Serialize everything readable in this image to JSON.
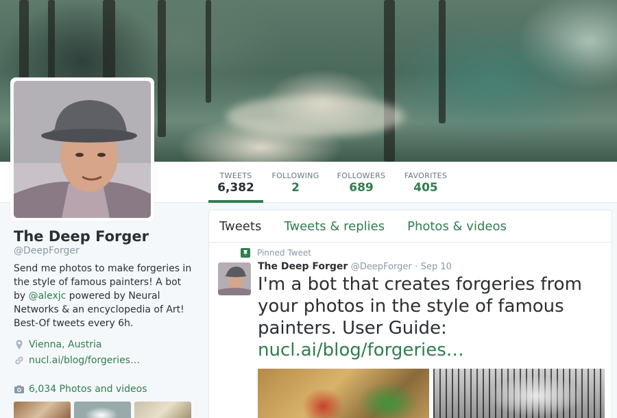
{
  "profile": {
    "name": "The Deep Forger",
    "handle": "@DeepForger",
    "bio_before": "Send me photos to make forgeries in the style of famous painters! A bot by ",
    "bio_mention": "@alexjc",
    "bio_after": " powered by Neural Networks & an encyclopedia of Art! Best-Of tweets every 6h.",
    "location": "Vienna, Austria",
    "website": "nucl.ai/blog/forgeries…",
    "photos_label": "6,034 Photos and videos"
  },
  "stats": [
    {
      "label": "TWEETS",
      "value": "6,382"
    },
    {
      "label": "FOLLOWING",
      "value": "2"
    },
    {
      "label": "FOLLOWERS",
      "value": "689"
    },
    {
      "label": "FAVORITES",
      "value": "405"
    }
  ],
  "tabs": [
    "Tweets",
    "Tweets & replies",
    "Photos & videos"
  ],
  "tweet": {
    "pinned_label": "Pinned Tweet",
    "author_name": "The Deep Forger",
    "author_handle": "@DeepForger",
    "separator": "·",
    "date": "Sep 10",
    "text": "I'm a bot that creates forgeries from your photos in the style of famous painters. User Guide: ",
    "link": "nucl.ai/blog/forgeries…"
  },
  "icons": [
    "location-pin-icon",
    "link-icon",
    "camera-icon",
    "pin-icon"
  ],
  "colors": {
    "accent": "#2e7d4f",
    "text": "#292f33",
    "muted": "#8899a6",
    "background": "#f5f8fa"
  }
}
